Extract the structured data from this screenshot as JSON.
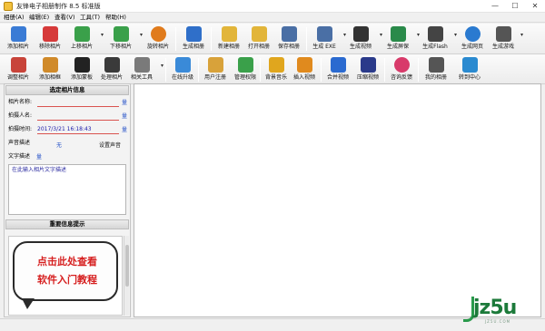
{
  "window": {
    "title": "友锋电子相册制作 8.5 标准版",
    "controls": {
      "minimize": "—",
      "maximize": "☐",
      "close": "✕"
    }
  },
  "menu": [
    {
      "label": "相册(A)",
      "icon": "menu-album"
    },
    {
      "label": "编辑(E)",
      "icon": "menu-edit"
    },
    {
      "label": "查看(V)",
      "icon": "menu-view"
    },
    {
      "label": "工具(T)",
      "icon": "menu-tools"
    },
    {
      "label": "帮助(H)",
      "icon": "menu-help"
    }
  ],
  "toolbar1": [
    {
      "label": "添加相片",
      "icon": "add-photo-icon",
      "color": "#3a7bd5"
    },
    {
      "label": "移除相片",
      "icon": "remove-photo-icon",
      "color": "#d63a3a"
    },
    {
      "label": "上移相片",
      "icon": "move-up-icon",
      "color": "#3aa04a"
    },
    {
      "label": "下移相片",
      "icon": "move-down-icon",
      "color": "#3aa04a"
    },
    {
      "label": "旋转相片",
      "icon": "rotate-photo-icon",
      "color": "#e07b1c"
    },
    {
      "label": "生成相册",
      "icon": "build-album-icon",
      "color": "#2f6fc9"
    },
    {
      "label": "新建相册",
      "icon": "new-album-icon",
      "color": "#e2b53a"
    },
    {
      "label": "打开相册",
      "icon": "open-album-icon",
      "color": "#e2b53a"
    },
    {
      "label": "保存相册",
      "icon": "save-album-icon",
      "color": "#4a6fa5"
    },
    {
      "label": "生成 EXE",
      "icon": "exe-icon",
      "color": "#4a6fa5"
    },
    {
      "label": "生成视频",
      "icon": "video-icon",
      "color": "#333333"
    },
    {
      "label": "生成屏保",
      "icon": "screensaver-icon",
      "color": "#2a8a4a"
    },
    {
      "label": "生成Flash",
      "icon": "flash-icon",
      "color": "#444444"
    },
    {
      "label": "生成网页",
      "icon": "webpage-icon",
      "color": "#2a7ad0"
    },
    {
      "label": "生成游戏",
      "icon": "game-icon",
      "color": "#555555"
    }
  ],
  "toolbar2": [
    {
      "label": "调整相片",
      "icon": "adjust-photo-icon",
      "color": "#c8443a"
    },
    {
      "label": "添加相框",
      "icon": "add-frame-icon",
      "color": "#d08a2a"
    },
    {
      "label": "添加蒙板",
      "icon": "add-mask-icon",
      "color": "#222222"
    },
    {
      "label": "处理相片",
      "icon": "process-photo-icon",
      "color": "#3a3a3a"
    },
    {
      "label": "相关工具",
      "icon": "tools-icon",
      "color": "#7a7a7a"
    },
    {
      "label": "在线升级",
      "icon": "upgrade-icon",
      "color": "#3a8ad8"
    },
    {
      "label": "用户注册",
      "icon": "register-icon",
      "color": "#d8a23a"
    },
    {
      "label": "管理权限",
      "icon": "permission-icon",
      "color": "#3aa04a"
    },
    {
      "label": "背景音乐",
      "icon": "music-icon",
      "color": "#e0a61e"
    },
    {
      "label": "插入视频",
      "icon": "insert-video-icon",
      "color": "#e08a1e"
    },
    {
      "label": "合并视频",
      "icon": "merge-video-icon",
      "color": "#2a6ad0"
    },
    {
      "label": "压缩视频",
      "icon": "compress-video-icon",
      "color": "#2a3a8a"
    },
    {
      "label": "咨询反馈",
      "icon": "feedback-icon",
      "color": "#d83a6a"
    },
    {
      "label": "我的相册",
      "icon": "my-album-icon",
      "color": "#555555"
    },
    {
      "label": "转到中心",
      "icon": "goto-center-icon",
      "color": "#2a8ad0"
    }
  ],
  "photo_info": {
    "header": "选定相片信息",
    "name_label": "相片名称:",
    "name_value": "",
    "author_label": "拍摄人名:",
    "author_value": "",
    "time_label": "拍摄时间:",
    "time_value": "2017/3/21 16:18:43",
    "sound_label": "声音描述",
    "sound_value": "无",
    "sound_set": "设置声音",
    "text_label": "文字描述",
    "desc_placeholder": "在此输入相片文字描述",
    "edit_btn": "量"
  },
  "tips": {
    "header": "重要信息提示",
    "line1": "点击此处查看",
    "line2": "软件入门教程"
  },
  "watermark": {
    "text": "jz5u",
    "sub": "JZ5U.COM"
  }
}
